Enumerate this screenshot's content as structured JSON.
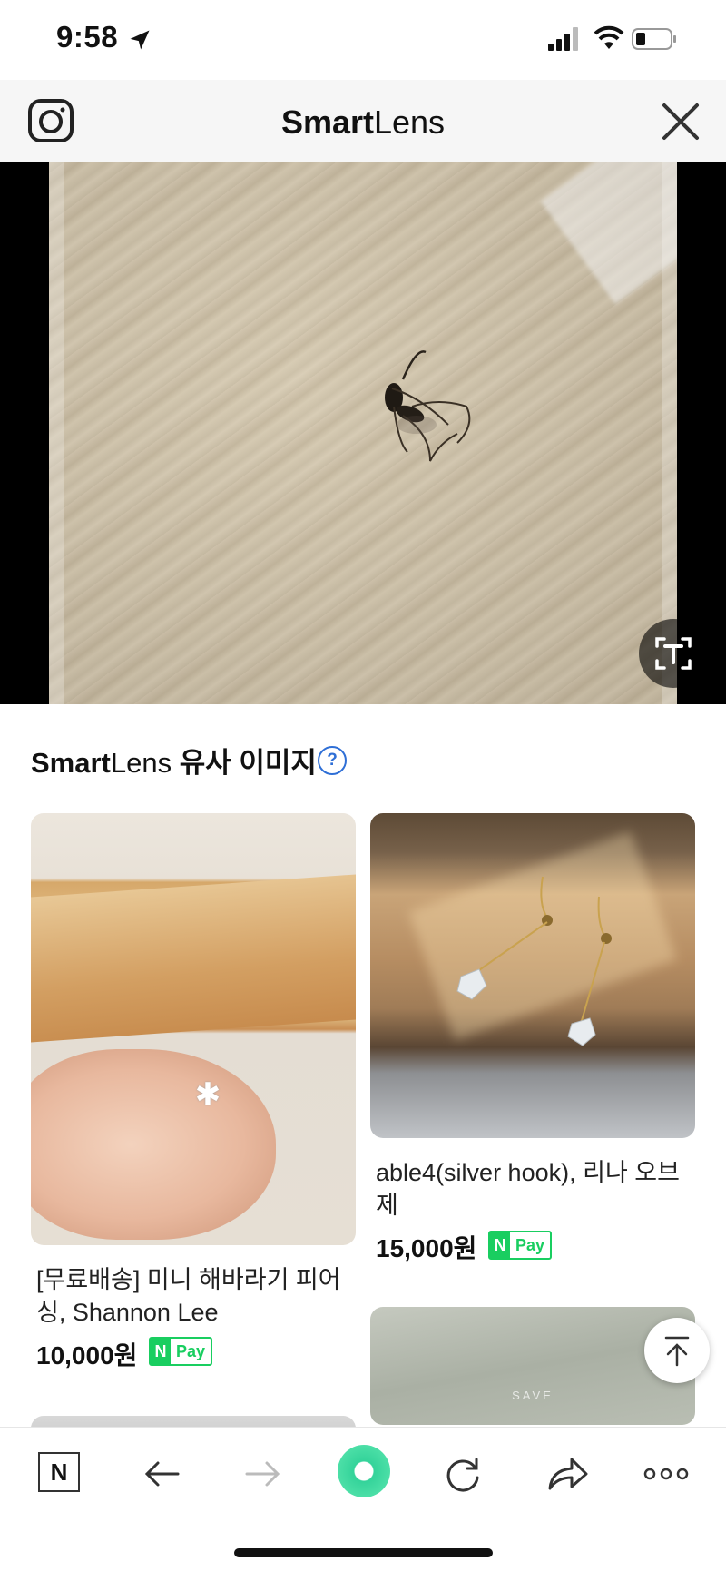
{
  "status_bar": {
    "time": "9:58"
  },
  "header": {
    "title_bold": "Smart",
    "title_light": "Lens"
  },
  "section": {
    "title_bold": "Smart",
    "title_light": "Lens",
    "title_rest": " 유사 이미지",
    "help_symbol": "?"
  },
  "products": [
    {
      "title": "[무료배송] 미니 해바라기 피어싱, Shannon Lee",
      "price": "10,000원",
      "pay_badge_n": "N",
      "pay_badge_text": "Pay"
    },
    {
      "title": "able4(silver hook), 리나 오브제",
      "price": "15,000원",
      "pay_badge_n": "N",
      "pay_badge_text": "Pay"
    }
  ],
  "third_image_watermark": "SAVE",
  "toolbar": {
    "home_label": "N"
  },
  "icons": [
    "location-arrow-icon",
    "signal-icon",
    "wifi-icon",
    "battery-icon",
    "camera-icon",
    "close-icon",
    "text-detect-icon",
    "help-icon",
    "scroll-top-icon",
    "back-arrow-icon",
    "forward-arrow-icon",
    "refresh-icon",
    "share-icon",
    "more-icon"
  ],
  "colors": {
    "npay_green": "#19ce60",
    "help_blue": "#2f6fd6",
    "lens_green": "#34d39a"
  }
}
